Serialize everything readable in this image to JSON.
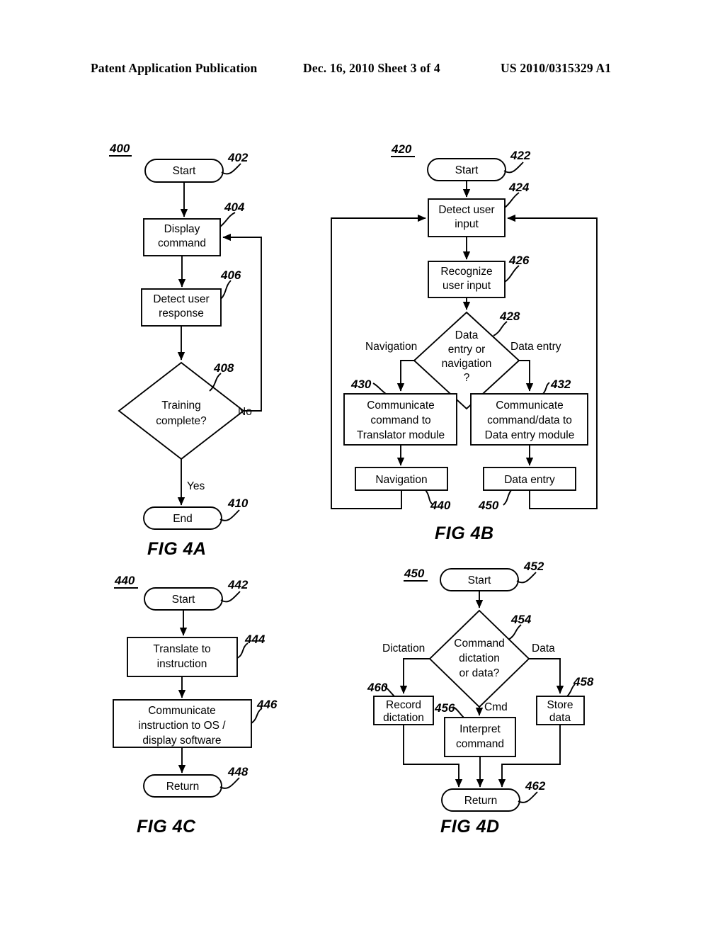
{
  "header": {
    "left": "Patent Application Publication",
    "middle": "Dec. 16, 2010   Sheet 3 of 4",
    "right": "US 2010/0315329 A1"
  },
  "figures": [
    {
      "id": "fig4a",
      "title": "FIG 4A",
      "diagram_ref": "400",
      "nodes": [
        {
          "ref": "402",
          "label": "Start",
          "shape": "terminator"
        },
        {
          "ref": "404",
          "label_line1": "Display",
          "label_line2": "command",
          "shape": "process"
        },
        {
          "ref": "406",
          "label_line1": "Detect user",
          "label_line2": "response",
          "shape": "process"
        },
        {
          "ref": "408",
          "label_line1": "Training",
          "label_line2": "complete?",
          "shape": "decision"
        },
        {
          "ref": "410",
          "label": "End",
          "shape": "terminator"
        }
      ],
      "edge_labels": [
        "No",
        "Yes"
      ]
    },
    {
      "id": "fig4b",
      "title": "FIG 4B",
      "diagram_ref": "420",
      "nodes": [
        {
          "ref": "422",
          "label": "Start",
          "shape": "terminator"
        },
        {
          "ref": "424",
          "label_line1": "Detect user",
          "label_line2": "input",
          "shape": "process"
        },
        {
          "ref": "426",
          "label_line1": "Recognize",
          "label_line2": "user input",
          "shape": "process"
        },
        {
          "ref": "428",
          "label_line1": "Data",
          "label_line2": "entry or",
          "label_line3": "navigation",
          "label_line4": "?",
          "shape": "decision"
        },
        {
          "ref": "430",
          "label_line1": "Communicate",
          "label_line2": "command to",
          "label_line3": "Translator module",
          "shape": "process"
        },
        {
          "ref": "432",
          "label_line1": "Communicate",
          "label_line2": "command/data to",
          "label_line3": "Data entry module",
          "shape": "process"
        },
        {
          "ref": "440",
          "label": "Navigation",
          "shape": "process"
        },
        {
          "ref": "450",
          "label": "Data entry",
          "shape": "process"
        }
      ],
      "edge_labels": [
        "Navigation",
        "Data entry"
      ]
    },
    {
      "id": "fig4c",
      "title": "FIG 4C",
      "diagram_ref": "440",
      "nodes": [
        {
          "ref": "442",
          "label": "Start",
          "shape": "terminator"
        },
        {
          "ref": "444",
          "label_line1": "Translate  to",
          "label_line2": "instruction",
          "shape": "process"
        },
        {
          "ref": "446",
          "label_line1": "Communicate",
          "label_line2": "instruction to OS /",
          "label_line3": "display software",
          "shape": "process"
        },
        {
          "ref": "448",
          "label": "Return",
          "shape": "terminator"
        }
      ],
      "edge_labels": []
    },
    {
      "id": "fig4d",
      "title": "FIG 4D",
      "diagram_ref": "450",
      "nodes": [
        {
          "ref": "452",
          "label": "Start",
          "shape": "terminator"
        },
        {
          "ref": "454",
          "label_line1": "Command",
          "label_line2": "dictation",
          "label_line3": "or data?",
          "shape": "decision"
        },
        {
          "ref": "460",
          "label_line1": "Record",
          "label_line2": "dictation",
          "shape": "process"
        },
        {
          "ref": "456",
          "label_line1": "Interpret",
          "label_line2": "command",
          "shape": "process"
        },
        {
          "ref": "458",
          "label_line1": "Store",
          "label_line2": "data",
          "shape": "process"
        },
        {
          "ref": "462",
          "label": "Return",
          "shape": "terminator"
        }
      ],
      "edge_labels": [
        "Dictation",
        "Data",
        "Cmd"
      ]
    }
  ],
  "fig4a": {
    "ref": "400",
    "title": "FIG 4A",
    "start": "Start",
    "start_ref": "402",
    "display_l1": "Display",
    "display_l2": "command",
    "display_ref": "404",
    "detect_l1": "Detect user",
    "detect_l2": "response",
    "detect_ref": "406",
    "decision_l1": "Training",
    "decision_l2": "complete?",
    "decision_ref": "408",
    "no_label": "No",
    "yes_label": "Yes",
    "end": "End",
    "end_ref": "410"
  },
  "fig4b": {
    "ref": "420",
    "title": "FIG 4B",
    "start": "Start",
    "start_ref": "422",
    "detect_l1": "Detect user",
    "detect_l2": "input",
    "detect_ref": "424",
    "recognize_l1": "Recognize",
    "recognize_l2": "user input",
    "recognize_ref": "426",
    "decision_l1": "Data",
    "decision_l2": "entry or",
    "decision_l3": "navigation",
    "decision_l4": "?",
    "decision_ref": "428",
    "nav_branch": "Navigation",
    "data_branch": "Data entry",
    "left_box_l1": "Communicate",
    "left_box_l2": "command to",
    "left_box_l3": "Translator module",
    "left_box_ref": "430",
    "right_box_l1": "Communicate",
    "right_box_l2": "command/data to",
    "right_box_l3": "Data entry module",
    "right_box_ref": "432",
    "nav_box": "Navigation",
    "nav_box_ref": "440",
    "data_box": "Data entry",
    "data_box_ref": "450"
  },
  "fig4c": {
    "ref": "440",
    "title": "FIG 4C",
    "start": "Start",
    "start_ref": "442",
    "translate_l1": "Translate  to",
    "translate_l2": "instruction",
    "translate_ref": "444",
    "comm_l1": "Communicate",
    "comm_l2": "instruction to OS /",
    "comm_l3": "display software",
    "comm_ref": "446",
    "return": "Return",
    "return_ref": "448"
  },
  "fig4d": {
    "ref": "450",
    "title": "FIG 4D",
    "start": "Start",
    "start_ref": "452",
    "decision_l1": "Command",
    "decision_l2": "dictation",
    "decision_l3": "or data?",
    "decision_ref": "454",
    "dictation_branch": "Dictation",
    "data_branch": "Data",
    "cmd_branch": "Cmd",
    "record_l1": "Record",
    "record_l2": "dictation",
    "record_ref": "460",
    "interpret_l1": "Interpret",
    "interpret_l2": "command",
    "interpret_ref": "456",
    "store_l1": "Store",
    "store_l2": "data",
    "store_ref": "458",
    "return": "Return",
    "return_ref": "462"
  }
}
